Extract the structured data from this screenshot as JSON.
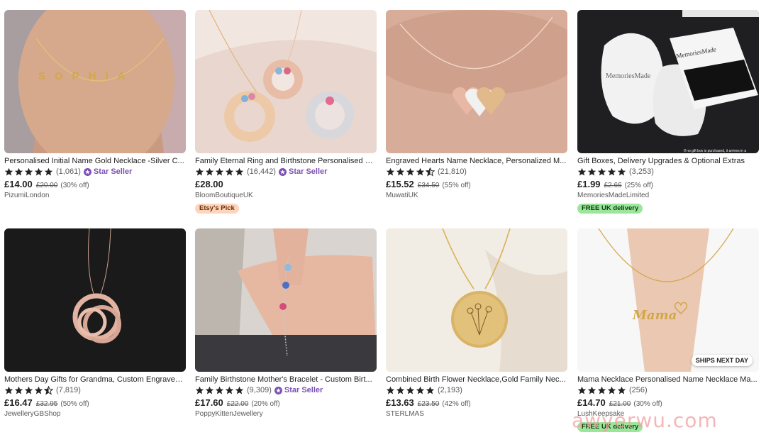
{
  "colors": {
    "star": "#222222",
    "star_seller": "#7b51b3",
    "free_delivery_bg": "#9ce69c",
    "etsys_pick_bg": "#fdd5bd"
  },
  "listings": [
    {
      "title": "Personalised Initial Name Gold Necklace -Silver C...",
      "rating": 5,
      "reviews": "(1,061)",
      "star_seller": "Star Seller",
      "price": "£14.00",
      "original_price": "£20.00",
      "discount": "(30% off)",
      "shop": "PizumiLondon",
      "badge": ""
    },
    {
      "title": "Family Eternal Ring and Birthstone Personalised N...",
      "rating": 5,
      "reviews": "(16,442)",
      "star_seller": "Star Seller",
      "price": "£28.00",
      "original_price": "",
      "discount": "",
      "shop": "BloomBoutiqueUK",
      "badge": "Etsy's Pick"
    },
    {
      "title": "Engraved Hearts Name Necklace, Personalized M...",
      "rating": 4.5,
      "reviews": "(21,810)",
      "star_seller": "",
      "price": "£15.52",
      "original_price": "£34.50",
      "discount": "(55% off)",
      "shop": "MuwatiUK",
      "badge": ""
    },
    {
      "title": "Gift Boxes, Delivery Upgrades & Optional Extras",
      "rating": 5,
      "reviews": "(3,253)",
      "star_seller": "",
      "price": "£1.99",
      "original_price": "£2.66",
      "discount": "(25% off)",
      "shop": "MemoriesMadeLimited",
      "badge": "FREE UK delivery"
    },
    {
      "title": "Mothers Day Gifts for Grandma, Custom Engraved...",
      "rating": 4.5,
      "reviews": "(7,819)",
      "star_seller": "",
      "price": "£16.47",
      "original_price": "£32.95",
      "discount": "(50% off)",
      "shop": "JewelleryGBShop",
      "badge": ""
    },
    {
      "title": "Family Birthstone Mother's Bracelet - Custom Birt...",
      "rating": 5,
      "reviews": "(9,309)",
      "star_seller": "Star Seller",
      "price": "£17.60",
      "original_price": "£22.00",
      "discount": "(20% off)",
      "shop": "PoppyKittenJewellery",
      "badge": ""
    },
    {
      "title": "Combined Birth Flower Necklace,Gold Family Nec...",
      "rating": 5,
      "reviews": "(2,193)",
      "star_seller": "",
      "price": "£13.63",
      "original_price": "£23.50",
      "discount": "(42% off)",
      "shop": "STERLMAS",
      "badge": ""
    },
    {
      "title": "Mama Necklace Personalised Name Necklace Ma...",
      "rating": 5,
      "reviews": "(256)",
      "star_seller": "",
      "price": "£14.70",
      "original_price": "£21.00",
      "discount": "(30% off)",
      "shop": "LushKeepsake",
      "badge": "FREE UK delivery"
    }
  ],
  "image_text": {
    "sophia": "SOPHIA",
    "brand": "MemoriesMade",
    "note": "If no gift box is purchased, it arrives in a",
    "mama": "Mama",
    "ships_next_day": "SHIPS NEXT DAY"
  },
  "watermark": "awyerwu.com"
}
